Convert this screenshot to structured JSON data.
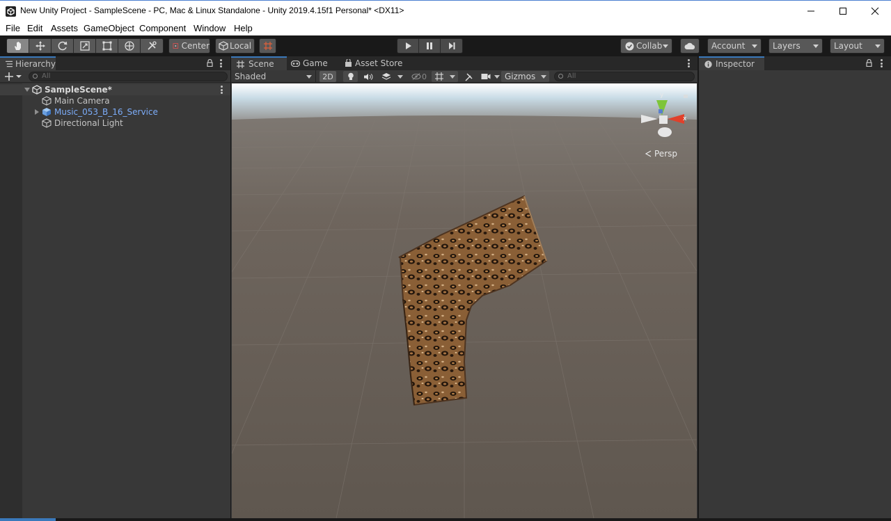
{
  "window": {
    "title": "New Unity Project - SampleScene - PC, Mac & Linux Standalone - Unity 2019.4.15f1 Personal* <DX11>",
    "controls": [
      "minimize-icon",
      "maximize-icon",
      "close-icon"
    ]
  },
  "menu": [
    "File",
    "Edit",
    "Assets",
    "GameObject",
    "Component",
    "Window",
    "Help"
  ],
  "toolbar": {
    "transform_tools": [
      "hand-icon",
      "move-icon",
      "rotate-icon",
      "scale-icon",
      "rect-tool-icon",
      "transform-tool-icon",
      "custom-tool-icon"
    ],
    "pivot_label": "Center",
    "space_label": "Local",
    "collab_label": "Collab",
    "account_label": "Account",
    "layers_label": "Layers",
    "layout_label": "Layout"
  },
  "hierarchy": {
    "tab_label": "Hierarchy",
    "search_placeholder": "All",
    "scene_name": "SampleScene*",
    "items": [
      {
        "label": "Main Camera",
        "icon": "gameobject-icon",
        "prefab": false
      },
      {
        "label": "Music_053_B_16_Service",
        "icon": "prefab-icon",
        "prefab": true
      },
      {
        "label": "Directional Light",
        "icon": "gameobject-icon",
        "prefab": false
      }
    ]
  },
  "scene_view": {
    "tabs": [
      {
        "label": "Scene",
        "icon": "scene-icon"
      },
      {
        "label": "Game",
        "icon": "game-icon"
      },
      {
        "label": "Asset Store",
        "icon": "asset-store-icon"
      }
    ],
    "shading_mode": "Shaded",
    "mode_2d": "2D",
    "hidden_count": "0",
    "gizmos_label": "Gizmos",
    "search_placeholder": "All",
    "persp_label": "Persp",
    "gizmo_axes": {
      "y": "y",
      "x": "x"
    }
  },
  "inspector": {
    "tab_label": "Inspector"
  },
  "colors": {
    "accent": "#3a79bb",
    "prefab_text": "#7cacf8",
    "sky": "#c8dbe6",
    "ground": "#6a615a"
  }
}
